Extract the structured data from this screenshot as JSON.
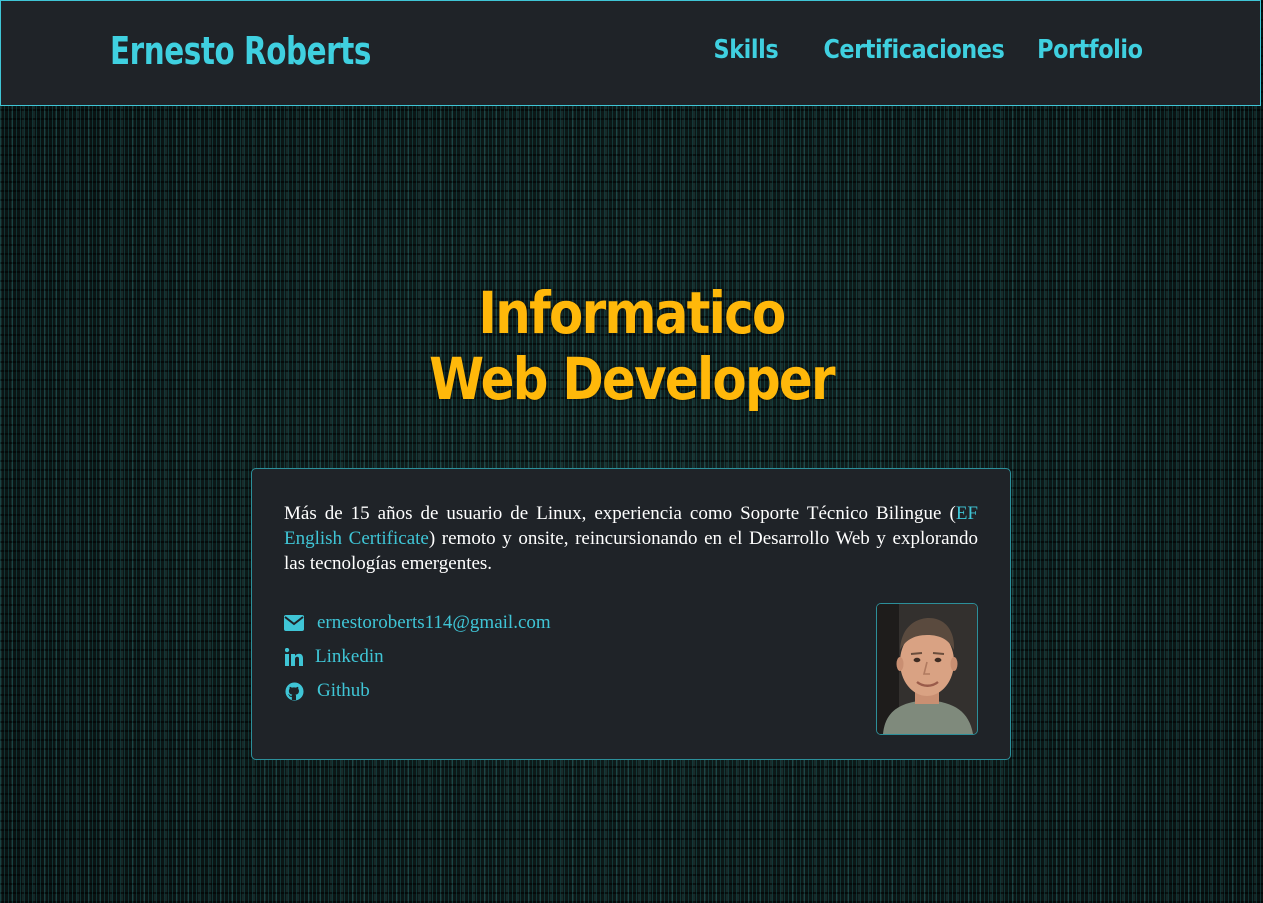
{
  "header": {
    "brand": "Ernesto Roberts",
    "nav": [
      {
        "label": "Skills"
      },
      {
        "label": "Certificaciones"
      },
      {
        "label": "Portfolio"
      }
    ]
  },
  "hero": {
    "line1": "Informatico",
    "line2": "Web Developer"
  },
  "card": {
    "bio_before": "Más de 15 años de usuario de Linux, experiencia como Soporte Técnico Bilingue (",
    "bio_link": "EF English Certificate",
    "bio_after": ") remoto y onsite, reincursionando en el Desarrollo Web y explorando las tecnologías emergentes.",
    "contacts": [
      {
        "icon": "envelope-icon",
        "label": "ernestoroberts114@gmail.com"
      },
      {
        "icon": "linkedin-icon",
        "label": "Linkedin"
      },
      {
        "icon": "github-icon",
        "label": "Github"
      }
    ]
  },
  "colors": {
    "accent": "#3fd0e0",
    "hero": "#ffb80a",
    "panel": "#1f2328"
  }
}
